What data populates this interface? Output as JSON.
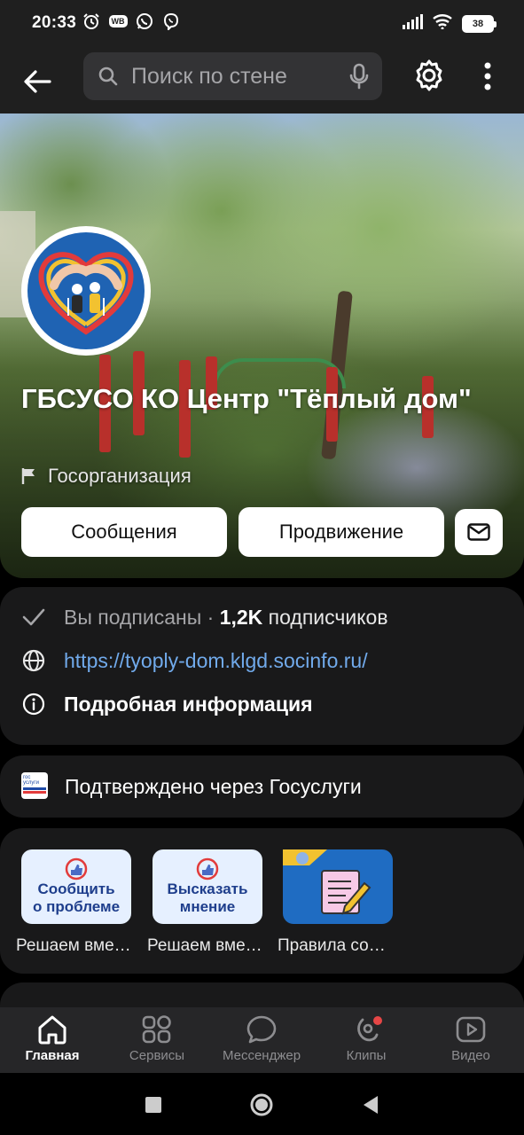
{
  "status_bar": {
    "time": "20:33",
    "wb_label": "WB",
    "battery": "38",
    "left_icons": [
      "alarm-icon",
      "wb-icon",
      "whatsapp-icon",
      "viber-icon"
    ],
    "right_icons": [
      "signal-icon",
      "wifi-icon",
      "battery-icon"
    ]
  },
  "toolbar": {
    "search_placeholder": "Поиск по стене",
    "icons": [
      "back-arrow-icon",
      "search-icon",
      "mic-icon",
      "gear-icon",
      "more-vertical-icon"
    ]
  },
  "group": {
    "name": "ГБСУСО КО Центр \"Тёплый дом\"",
    "type": "Госорганизация",
    "buttons": {
      "messages": "Сообщения",
      "promotion": "Продвижение"
    }
  },
  "info": {
    "subscribed": "Вы подписаны",
    "separator": " · ",
    "subscribers_count": "1,2K",
    "subscribers_word": " подписчиков",
    "website": "https://tyoply-dom.klgd.socinfo.ru/",
    "details": "Подробная информация"
  },
  "verification": {
    "logo_text": "гос услуги",
    "text": "Подтверждено через Госуслуги"
  },
  "apps": [
    {
      "tile_line1": "Сообщить",
      "tile_line2": "о проблеме",
      "label": "Решаем вме…"
    },
    {
      "tile_line1": "Высказать",
      "tile_line2": "мнение",
      "label": "Решаем вме…"
    },
    {
      "tile_line1": "",
      "tile_line2": "",
      "label": "Правила со…"
    }
  ],
  "bottom_nav": {
    "items": [
      {
        "label": "Главная",
        "icon": "home-icon",
        "active": true
      },
      {
        "label": "Сервисы",
        "icon": "services-icon",
        "active": false
      },
      {
        "label": "Мессенджер",
        "icon": "messenger-icon",
        "active": false
      },
      {
        "label": "Клипы",
        "icon": "clips-icon",
        "active": false,
        "badge": true
      },
      {
        "label": "Видео",
        "icon": "video-icon",
        "active": false
      }
    ]
  },
  "colors": {
    "link": "#71aaeb",
    "card_bg": "#19191a",
    "badge": "#e64646",
    "avatar_blue": "#1f63b3"
  }
}
